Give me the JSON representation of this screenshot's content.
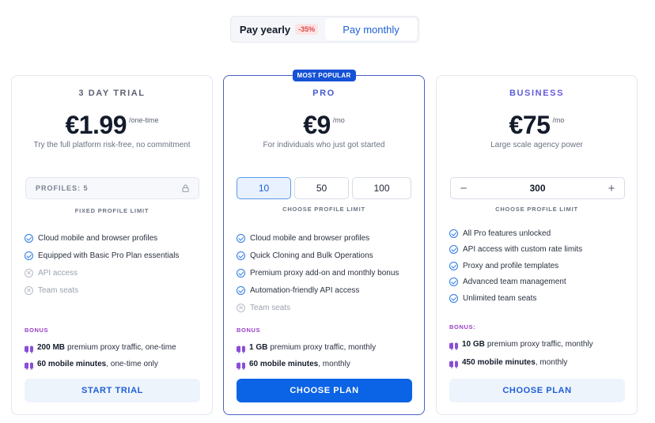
{
  "billing": {
    "yearly_label": "Pay yearly",
    "discount": "-35%",
    "monthly_label": "Pay monthly",
    "selected": "monthly"
  },
  "plans": [
    {
      "name": "3 DAY TRIAL",
      "price": "€1.99",
      "period": "/one-time",
      "tagline": "Try the full platform risk-free, no commitment",
      "profiles_label": "PROFILES: 5",
      "profiles_caption": "FIXED PROFILE LIMIT",
      "features": [
        {
          "text": "Cloud mobile and browser profiles",
          "included": true
        },
        {
          "text": "Equipped with Basic Pro Plan essentials",
          "included": true
        },
        {
          "text": "API access",
          "included": false
        },
        {
          "text": "Team seats",
          "included": false
        }
      ],
      "bonus_label": "BONUS",
      "bonus": [
        {
          "amount": "200 MB",
          "text": "premium proxy traffic, one-time"
        },
        {
          "amount": "60 mobile minutes",
          "text": ", one-time only"
        }
      ],
      "cta": "START TRIAL"
    },
    {
      "name": "PRO",
      "badge": "MOST POPULAR",
      "price": "€9",
      "period": "/mo",
      "tagline": "For individuals who just got started",
      "profile_options": [
        "10",
        "50",
        "100"
      ],
      "selected_option": "10",
      "profiles_caption": "CHOOSE PROFILE LIMIT",
      "features": [
        {
          "text": "Cloud mobile and browser profiles",
          "included": true
        },
        {
          "text": "Quick Cloning and Bulk Operations",
          "included": true
        },
        {
          "text": "Premium proxy add-on and monthly bonus",
          "included": true
        },
        {
          "text": "Automation-friendly API access",
          "included": true
        },
        {
          "text": "Team seats",
          "included": false
        }
      ],
      "bonus_label": "BONUS",
      "bonus": [
        {
          "amount": "1 GB",
          "text": "premium proxy traffic, monthly"
        },
        {
          "amount": "60 mobile minutes",
          "text": ", monthly"
        }
      ],
      "cta": "CHOOSE PLAN"
    },
    {
      "name": "BUSINESS",
      "price": "€75",
      "period": "/mo",
      "tagline": "Large scale agency power",
      "stepper": {
        "minus": "−",
        "value": "300",
        "plus": "+"
      },
      "profiles_caption": "CHOOSE PROFILE LIMIT",
      "features": [
        {
          "text": "All Pro features unlocked",
          "included": true
        },
        {
          "text": "API access with custom rate limits",
          "included": true
        },
        {
          "text": "Proxy and profile templates",
          "included": true
        },
        {
          "text": "Advanced team management",
          "included": true
        },
        {
          "text": "Unlimited team seats",
          "included": true
        }
      ],
      "bonus_label": "BONUS:",
      "bonus": [
        {
          "amount": "10 GB",
          "text": "premium proxy traffic, monthly"
        },
        {
          "amount": "450 mobile minutes",
          "text": ", monthly"
        }
      ],
      "cta": "CHOOSE PLAN"
    }
  ]
}
